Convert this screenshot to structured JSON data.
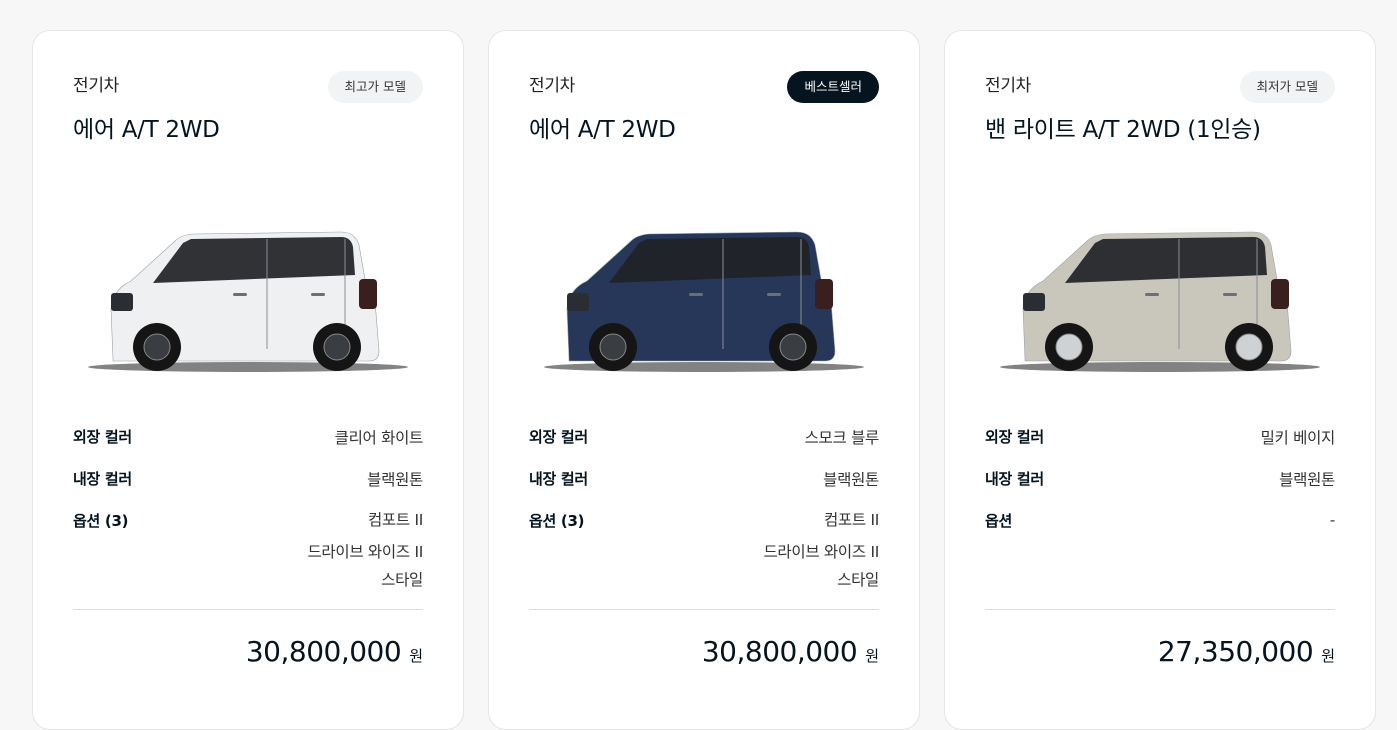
{
  "cards": [
    {
      "category": "전기차",
      "model": "에어 A/T 2WD",
      "badge": "최고가 모델",
      "car_color": "#eef0f2",
      "specs": {
        "exterior_label": "외장 컬러",
        "exterior_value": "클리어 화이트",
        "interior_label": "내장 컬러",
        "interior_value": "블랙원톤",
        "options_label": "옵션 (3)",
        "options": [
          "컴포트 II",
          "드라이브 와이즈 II",
          "스타일"
        ]
      },
      "price": "30,800,000",
      "price_unit": "원"
    },
    {
      "category": "전기차",
      "model": "에어 A/T 2WD",
      "badge": "베스트셀러",
      "car_color": "#26375a",
      "specs": {
        "exterior_label": "외장 컬러",
        "exterior_value": "스모크 블루",
        "interior_label": "내장 컬러",
        "interior_value": "블랙원톤",
        "options_label": "옵션 (3)",
        "options": [
          "컴포트 II",
          "드라이브 와이즈 II",
          "스타일"
        ]
      },
      "price": "30,800,000",
      "price_unit": "원"
    },
    {
      "category": "전기차",
      "model": "밴 라이트 A/T 2WD (1인승)",
      "badge": "최저가 모델",
      "car_color": "#c9c7bb",
      "specs": {
        "exterior_label": "외장 컬러",
        "exterior_value": "밀키 베이지",
        "interior_label": "내장 컬러",
        "interior_value": "블랙원톤",
        "options_label": "옵션",
        "options": [
          "-"
        ]
      },
      "price": "27,350,000",
      "price_unit": "원"
    }
  ]
}
